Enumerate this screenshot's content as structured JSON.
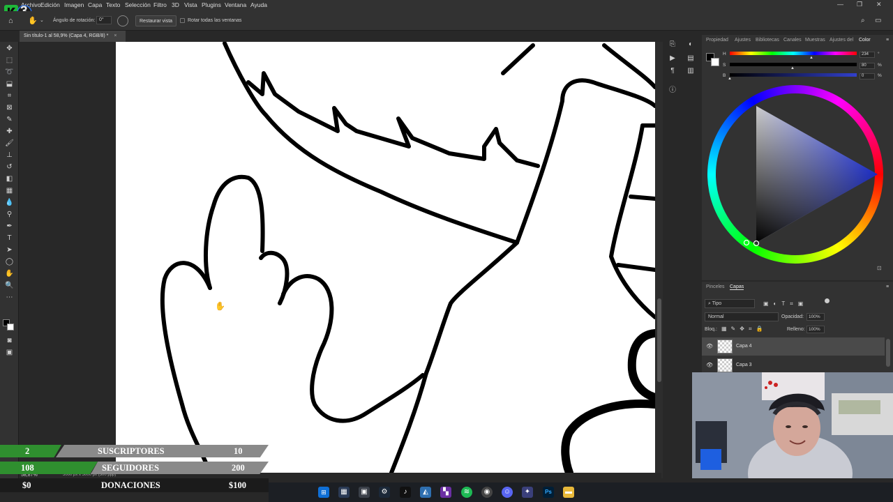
{
  "app": {
    "logo_text": "3",
    "menu": [
      "Archivo",
      "Edición",
      "Imagen",
      "Capa",
      "Texto",
      "Selección",
      "Filtro",
      "3D",
      "Vista",
      "Plugins",
      "Ventana",
      "Ayuda"
    ],
    "window_controls": [
      "—",
      "❐",
      "✕"
    ]
  },
  "options_bar": {
    "rotation_label": "Ángulo de rotación:",
    "rotation_value": "0°",
    "reset_view_label": "Restaurar vista",
    "rotate_all_label": "Rotar todas las ventanas"
  },
  "document": {
    "tab_title": "Sin título-1 al 58,9% (Capa 4, RGB/8) *",
    "zoom": "58,87%",
    "doc_info": "5000 px x 5000 px (300 ppp)"
  },
  "color_panel": {
    "tabs": [
      "Propiedad",
      "Ajustes",
      "Bibliotecas",
      "Canales",
      "Muestras",
      "Ajustes del",
      "Color"
    ],
    "sliders": [
      {
        "label": "H",
        "value": "234",
        "unit": "°"
      },
      {
        "label": "S",
        "value": "80",
        "unit": "%"
      },
      {
        "label": "B",
        "value": "0",
        "unit": "%"
      }
    ]
  },
  "layers_panel": {
    "tabs": [
      "Pinceles",
      "Capas"
    ],
    "filter_label": "Tipo",
    "blend_mode": "Normal",
    "opacity_label": "Opacidad:",
    "opacity_value": "100%",
    "lock_label": "Bloq.:",
    "fill_label": "Relleno:",
    "fill_value": "100%",
    "layers": [
      {
        "name": "Capa 4",
        "selected": true
      },
      {
        "name": "Capa 3",
        "selected": false
      }
    ]
  },
  "stream_overlay": {
    "rows": [
      {
        "current": "2",
        "label": "SUSCRIPTORES",
        "goal": "10"
      },
      {
        "current": "108",
        "label": "SEGUIDORES",
        "goal": "200"
      },
      {
        "current": "$0",
        "label": "DONACIONES",
        "goal": "$100"
      }
    ]
  },
  "colors": {
    "accent_green": "#2e8b2e",
    "bar_gray": "#8a8a8a",
    "ps_bg": "#323232"
  }
}
